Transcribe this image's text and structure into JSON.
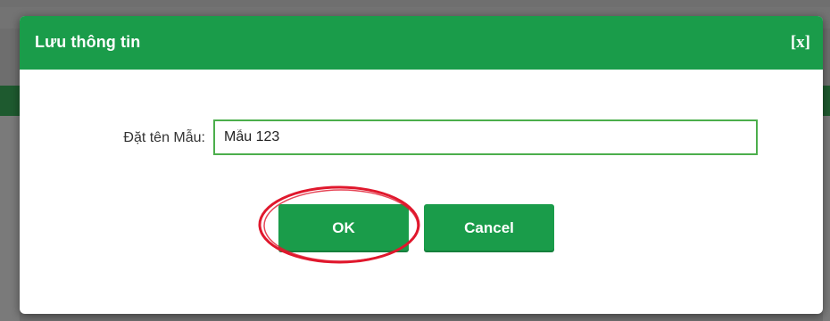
{
  "dialog": {
    "title": "Lưu thông tin",
    "close_label": "[x]",
    "field_label": "Đặt tên Mẫu:",
    "field_value": "Mẫu 123",
    "ok_label": "OK",
    "cancel_label": "Cancel"
  },
  "colors": {
    "accent": "#1a9c4a",
    "highlight": "#e0182d",
    "input_border": "#4cae4c"
  }
}
